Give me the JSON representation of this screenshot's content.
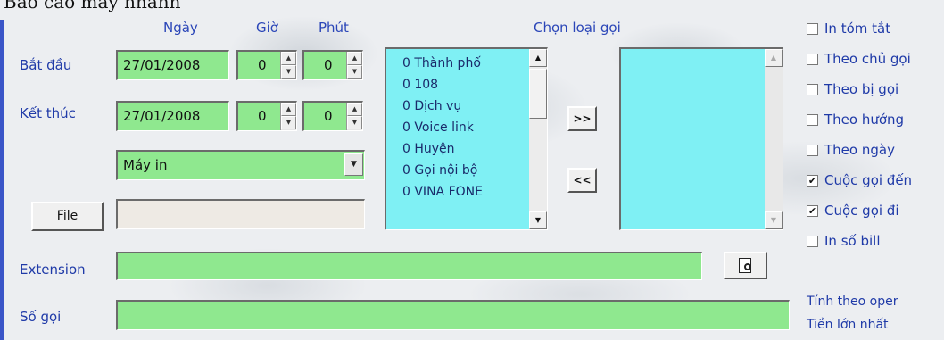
{
  "window": {
    "title": "Báo cáo máy nhánh"
  },
  "columns": {
    "date": "Ngày",
    "hour": "Giờ",
    "minute": "Phút",
    "call_type": "Chọn loại gọi"
  },
  "start": {
    "label": "Bắt đầu",
    "date": "27/01/2008",
    "hour": "0",
    "minute": "0"
  },
  "end": {
    "label": "Kết thúc",
    "date": "27/01/2008",
    "hour": "0",
    "minute": "0"
  },
  "printer": {
    "selected": "Máy in"
  },
  "file": {
    "button_label": "File",
    "path": ""
  },
  "call_types": {
    "available": [
      "0 Thành phố",
      "0 108",
      "0 Dịch vụ",
      "0 Voice link",
      "0 Huyện",
      "0 Gọi nội bộ",
      "0 VINA FONE"
    ],
    "selected": [],
    "add_label": ">>",
    "remove_label": "<<"
  },
  "options": [
    {
      "label": "In tóm tắt",
      "checked": false
    },
    {
      "label": "Theo chủ gọi",
      "checked": false
    },
    {
      "label": "Theo bị gọi",
      "checked": false
    },
    {
      "label": "Theo hướng",
      "checked": false
    },
    {
      "label": "Theo ngày",
      "checked": false
    },
    {
      "label": "Cuộc gọi đến",
      "checked": true
    },
    {
      "label": "Cuộc gọi đi",
      "checked": true
    },
    {
      "label": "In số bill",
      "checked": false
    }
  ],
  "extension": {
    "label": "Extension",
    "value": ""
  },
  "number": {
    "label": "Số gọi",
    "value": ""
  },
  "notes": {
    "by_operator": "Tính theo oper",
    "max_amount": "Tiền lớn nhất"
  },
  "colors": {
    "field_green": "#8fe88f",
    "list_cyan": "#7ff0f4",
    "label_blue": "#1f3aa8"
  }
}
